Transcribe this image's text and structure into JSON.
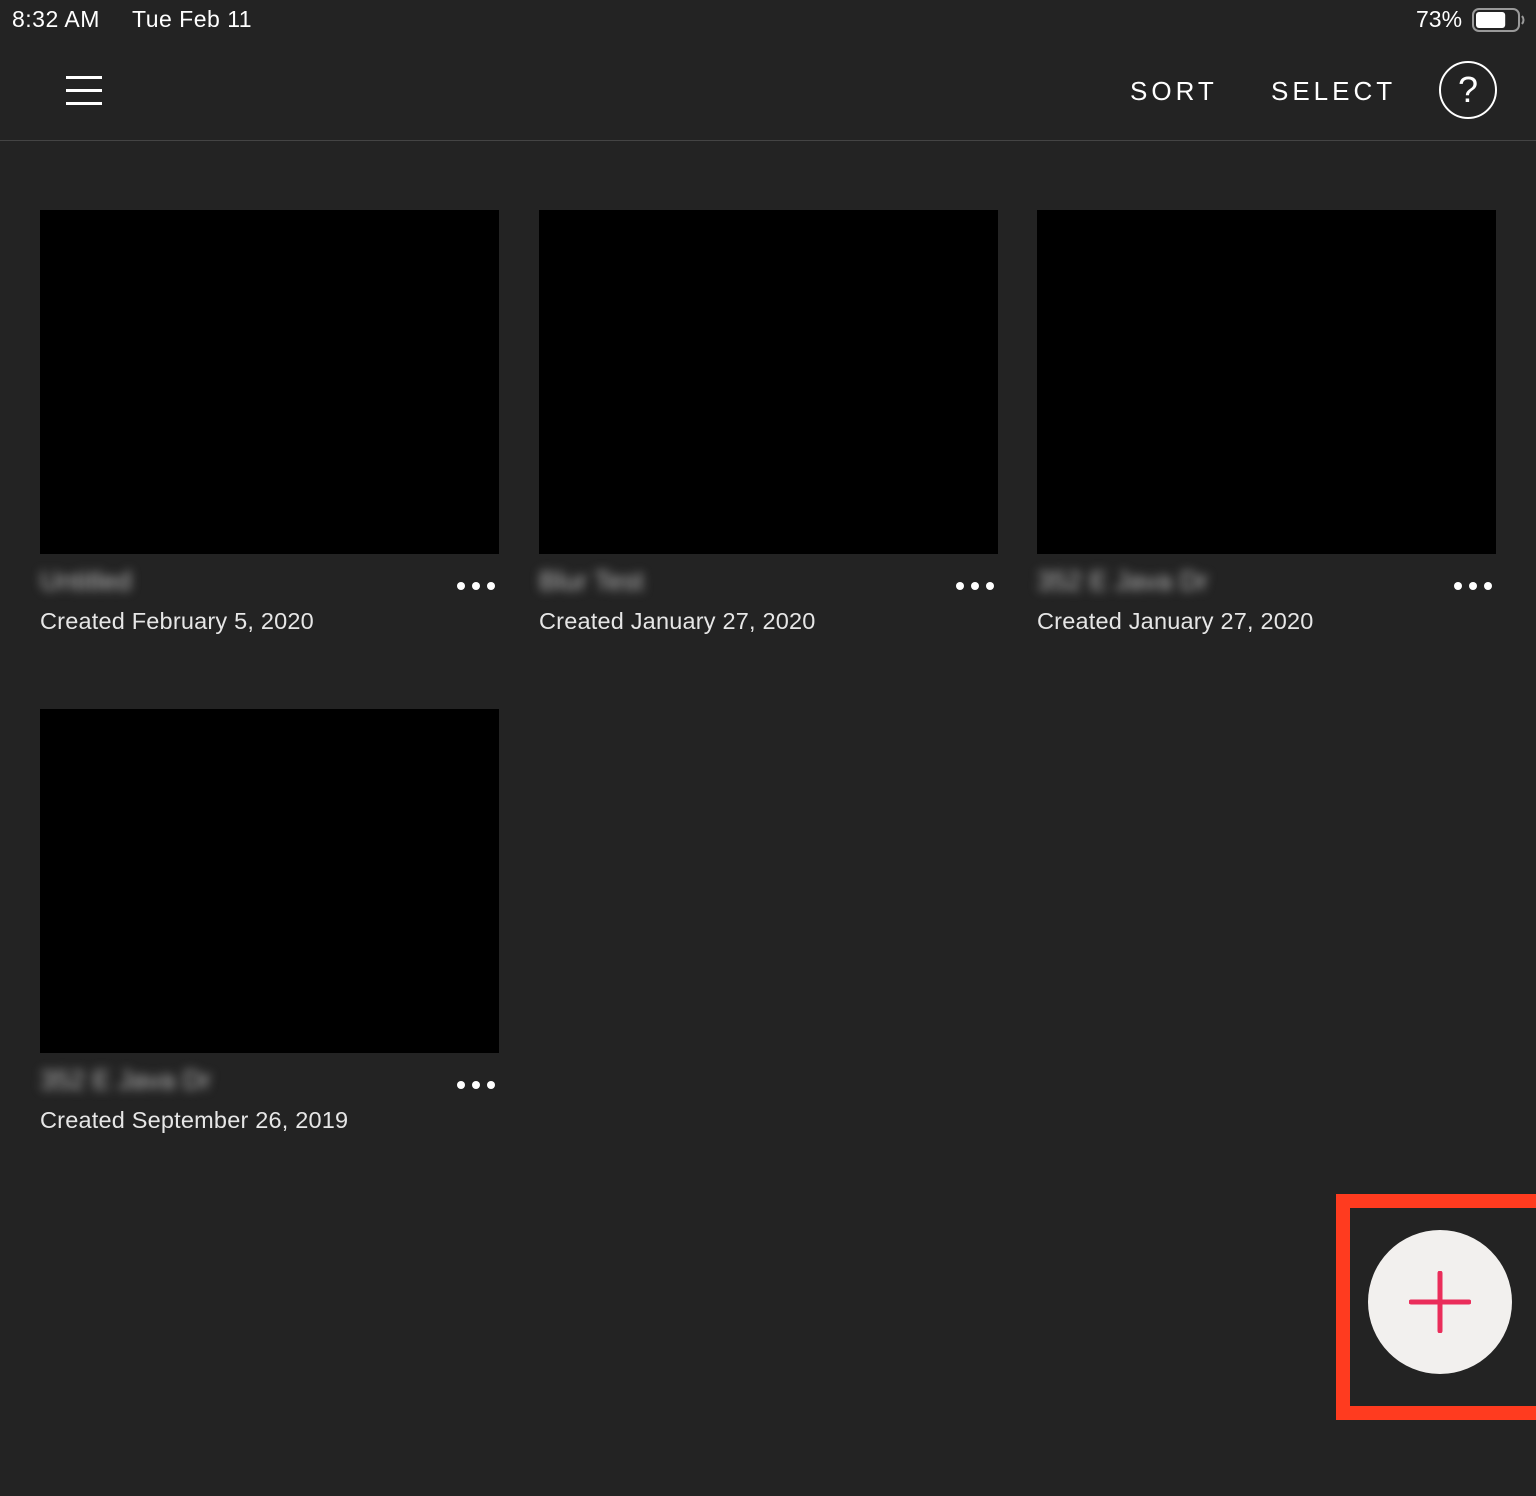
{
  "status_bar": {
    "time": "8:32 AM",
    "date": "Tue Feb 11",
    "battery_percent": "73%",
    "battery_icon": "battery-icon",
    "battery_level": 0.73
  },
  "toolbar": {
    "menu_icon": "hamburger-menu-icon",
    "sort_label": "SORT",
    "select_label": "SELECT",
    "help_icon": "question-circle-icon",
    "help_glyph": "?"
  },
  "projects": [
    {
      "title": "Untitled",
      "date": "Created February 5, 2020"
    },
    {
      "title": "Blur Test",
      "date": "Created January 27, 2020"
    },
    {
      "title": "352 E Java Dr",
      "date": "Created January 27, 2020"
    },
    {
      "title": "352 E Java Dr",
      "date": "Created September 26, 2019"
    }
  ],
  "card_more_icon": "more-horizontal-icon",
  "fab": {
    "icon": "plus-icon"
  },
  "colors": {
    "background": "#232323",
    "thumbnail": "#000000",
    "fab_background": "#f2f0ee",
    "fab_plus": "#ea2d5a",
    "highlight_box": "#ff3b1f"
  }
}
